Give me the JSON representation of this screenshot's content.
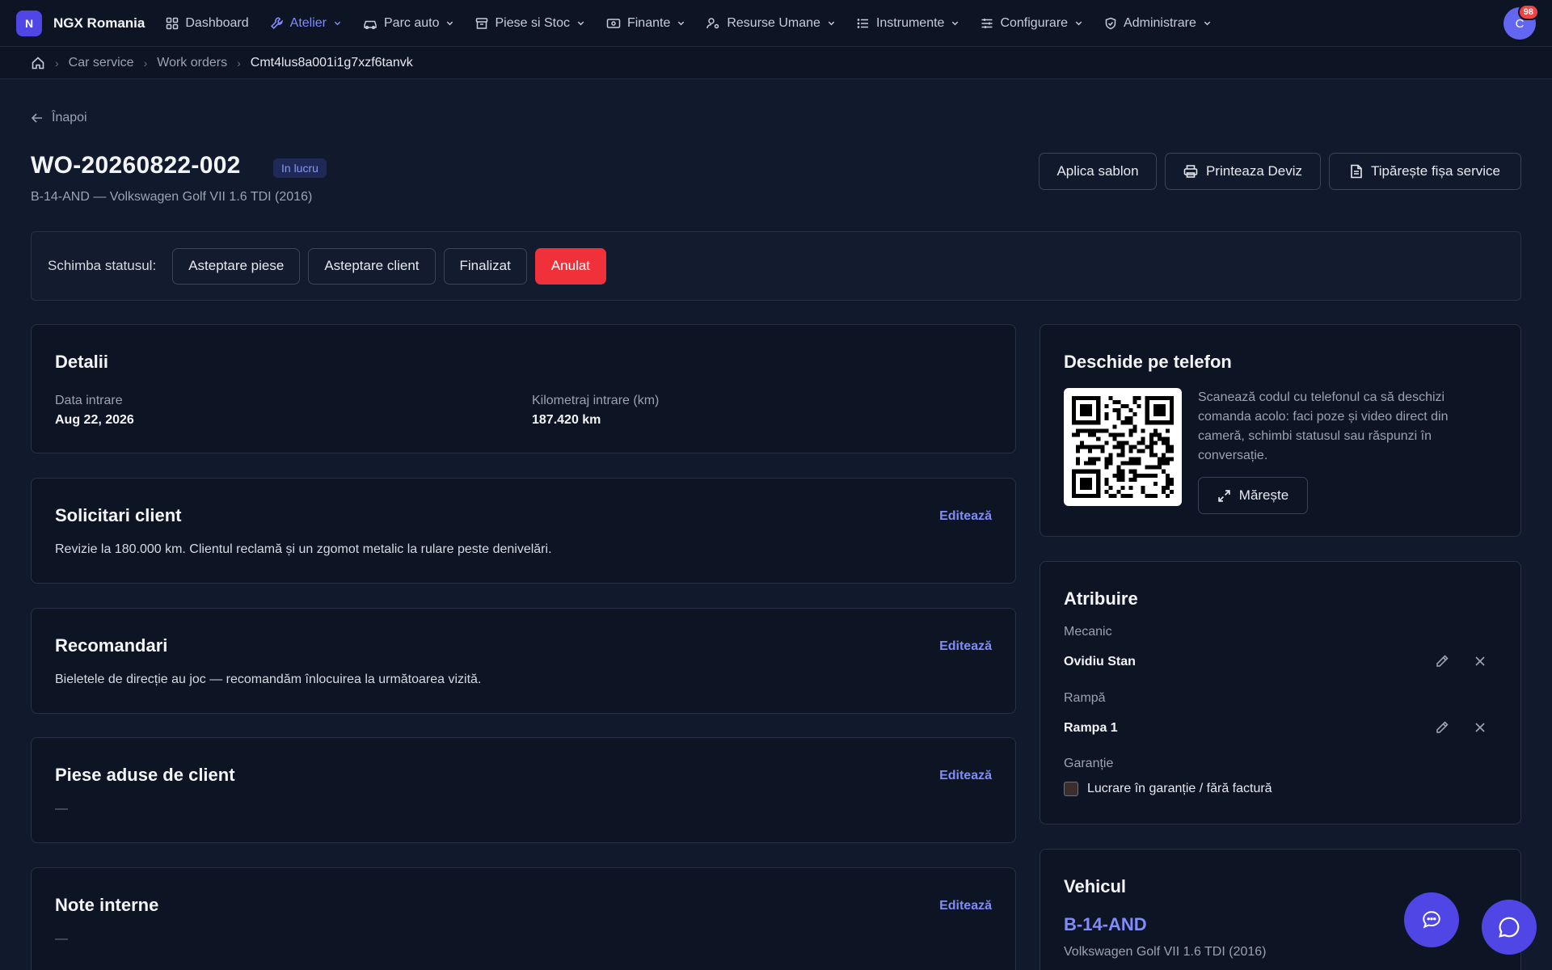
{
  "topnav": {
    "brand_initial": "N",
    "brand_name": "NGX Romania",
    "items": [
      {
        "label": "Dashboard"
      },
      {
        "label": "Atelier"
      },
      {
        "label": "Parc auto"
      },
      {
        "label": "Piese si Stoc"
      },
      {
        "label": "Finante"
      },
      {
        "label": "Resurse Umane"
      },
      {
        "label": "Instrumente"
      },
      {
        "label": "Configurare"
      },
      {
        "label": "Administrare"
      }
    ],
    "avatar_initial": "C",
    "notification_count": "98"
  },
  "breadcrumb": [
    "Car service",
    "Work orders",
    "Cmt4lus8a001i1g7xzf6tanvk"
  ],
  "header": {
    "back_label": "Înapoi",
    "title": "WO-20260822-002",
    "status": "In lucru",
    "subtitle": "B-14-AND — Volkswagen Golf VII 1.6 TDI (2016)",
    "buttons": {
      "apply_template": "Aplica sablon",
      "print_quote": "Printeaza Deviz",
      "print_sheet": "Tipărește fișa service"
    }
  },
  "status_change": {
    "label": "Schimba statusul:",
    "options": [
      "Asteptare piese",
      "Asteptare client",
      "Finalizat",
      "Anulat"
    ]
  },
  "details": {
    "title": "Detalii",
    "entry_date_label": "Data intrare",
    "entry_date": "Aug 22, 2026",
    "mileage_label": "Kilometraj intrare (km)",
    "mileage": "187.420 km"
  },
  "client_requests": {
    "title": "Solicitari client",
    "edit": "Editează",
    "text": "Revizie la 180.000 km. Clientul reclamă și un zgomot metalic la rulare peste denivelări."
  },
  "recommendations": {
    "title": "Recomandari",
    "edit": "Editează",
    "text": "Bieletele de direcție au joc — recomandăm înlocuirea la următoarea vizită."
  },
  "client_parts": {
    "title": "Piese aduse de client",
    "edit": "Editează",
    "text": "—"
  },
  "internal_notes": {
    "title": "Note interne",
    "edit": "Editează",
    "text": "—"
  },
  "phone": {
    "title": "Deschide pe telefon",
    "description": "Scanează codul cu telefonul ca să deschizi comanda acolo: faci poze și video direct din cameră, schimbi statusul sau răspunzi în conversație.",
    "enlarge": "Mărește"
  },
  "assignment": {
    "title": "Atribuire",
    "mechanic_label": "Mecanic",
    "mechanic": "Ovidiu Stan",
    "ramp_label": "Rampă",
    "ramp": "Rampa 1",
    "warranty_label": "Garanție",
    "warranty_checkbox": "Lucrare în garanție / fără factură"
  },
  "vehicle": {
    "title": "Vehicul",
    "plate": "B-14-AND",
    "description": "Volkswagen Golf VII 1.6 TDI (2016)"
  },
  "colors": {
    "accent": "#818cf8",
    "brand": "#4f46e5",
    "danger": "#f0313a",
    "background": "#111a2c",
    "card": "#0d1424"
  }
}
